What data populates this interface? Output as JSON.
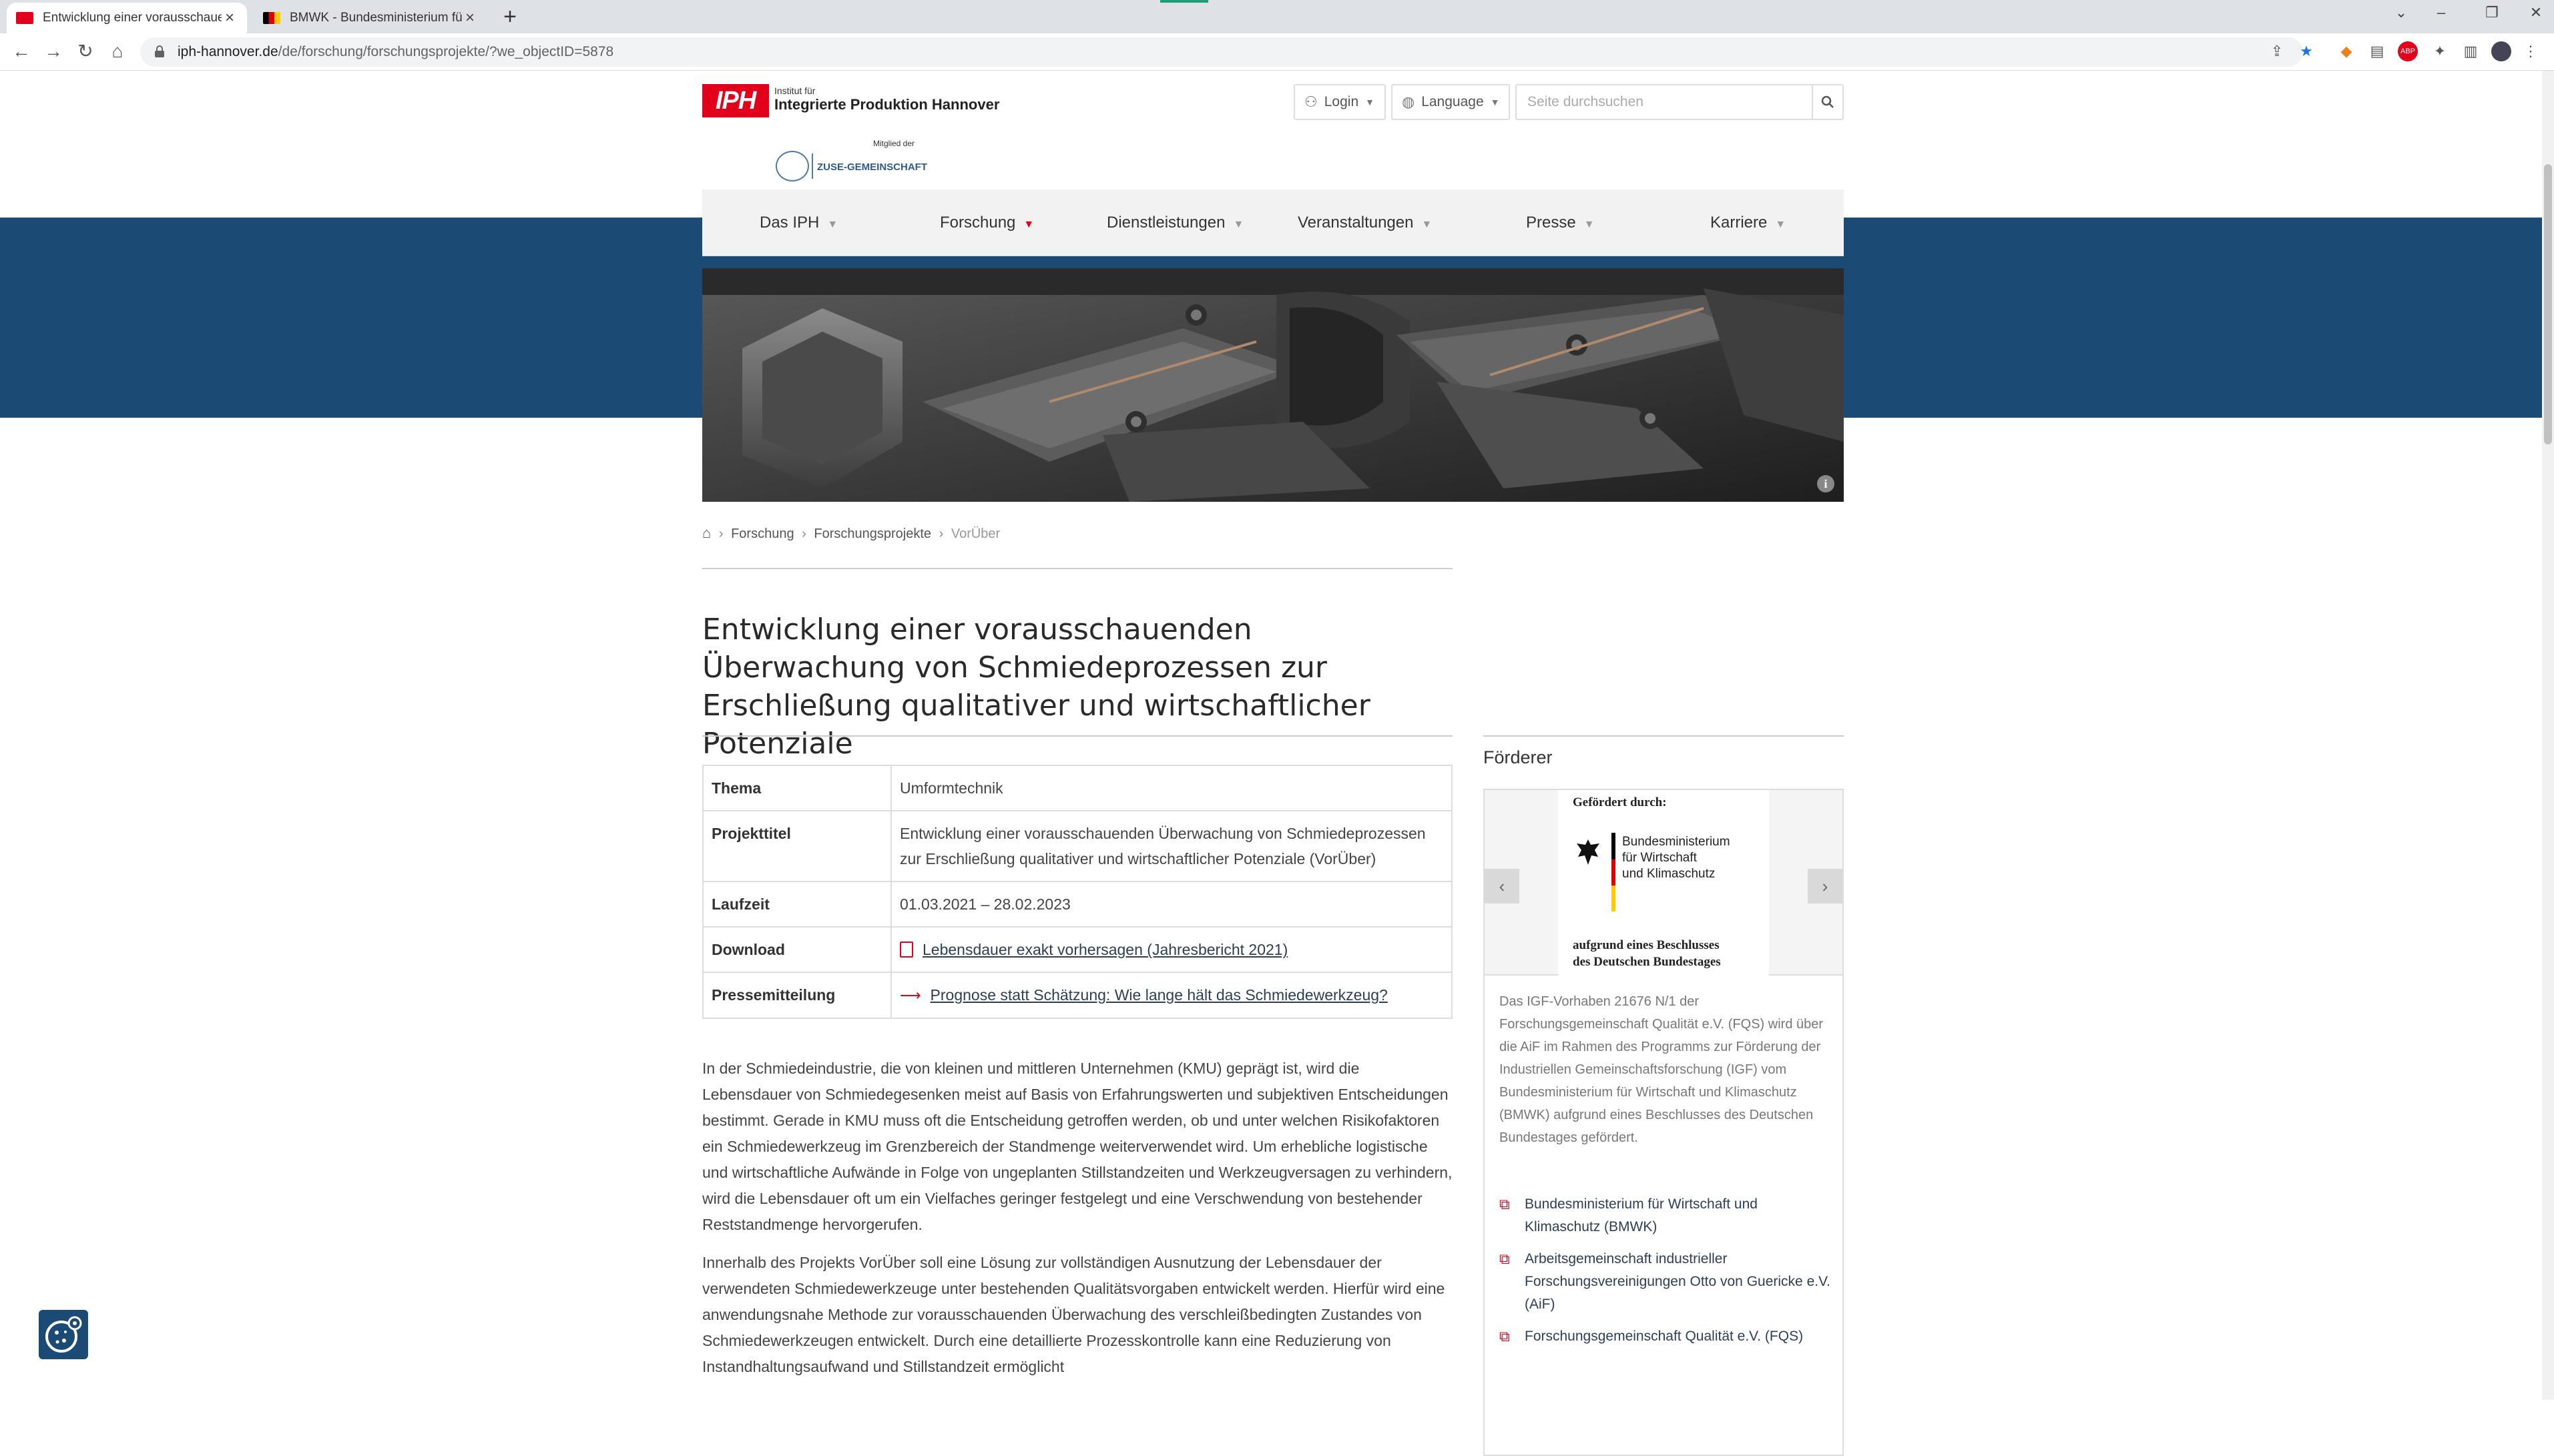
{
  "browser": {
    "tabs": [
      {
        "title": "Entwicklung einer vorausschauenden Überwachung",
        "active": true
      },
      {
        "title": "BMWK - Bundesministerium für Wirtschaft und Klimaschutz",
        "active": false
      }
    ],
    "url_host": "iph-hannover.de",
    "url_path": "/de/forschung/forschungsprojekte/?we_objectID=5878"
  },
  "header": {
    "logo_mark": "IPH",
    "logo_small": "Institut für",
    "logo_name": "Integrierte Produktion Hannover",
    "member_label": "Mitglied der",
    "zuse_label": "ZUSE-GEMEINSCHAFT",
    "login_label": "Login",
    "language_label": "Language",
    "search_placeholder": "Seite durchsuchen"
  },
  "nav": {
    "items": [
      "Das IPH",
      "Forschung",
      "Dienstleistungen",
      "Veranstaltungen",
      "Presse",
      "Karriere"
    ]
  },
  "breadcrumb": {
    "items": [
      "Forschung",
      "Forschungsprojekte"
    ],
    "current": "VorÜber"
  },
  "page_title": "Entwicklung einer vorausschauenden Überwachung von Schmiedeprozessen zur Erschließung qualitativer und wirtschaftlicher Potenziale",
  "info": {
    "thema_label": "Thema",
    "thema_value": "Umformtechnik",
    "projekttitel_label": "Projekttitel",
    "projekttitel_value": "Entwicklung einer vorausschauenden Überwachung von Schmiedeprozessen zur Erschließung qualitativer und wirtschaftlicher Potenziale (VorÜber)",
    "laufzeit_label": "Laufzeit",
    "laufzeit_value": "01.03.2021 – 28.02.2023",
    "download_label": "Download",
    "download_link": "Lebensdauer exakt vorhersagen (Jahresbericht 2021)",
    "presse_label": "Pressemitteilung",
    "presse_link": "Prognose statt Schätzung: Wie lange hält das Schmiedewerkzeug?"
  },
  "body": {
    "p1": "In der Schmiedeindustrie, die von kleinen und mittleren Unternehmen (KMU) geprägt ist, wird die Lebensdauer von Schmiedegesenken meist auf Basis von Erfahrungswerten und subjektiven Entscheidungen bestimmt. Gerade in KMU muss oft die Entscheidung getroffen werden, ob und unter welchen Risikofaktoren ein Schmiedewerkzeug im Grenzbereich der Standmenge weiterverwendet wird. Um erhebliche logistische und wirtschaftliche Aufwände in Folge von ungeplanten Stillstandzeiten und Werkzeugversagen zu verhindern, wird die Lebensdauer oft um ein Vielfaches geringer festgelegt und eine Verschwendung von bestehender Reststandmenge hervorgerufen.",
    "p2": "Innerhalb des Projekts VorÜber soll eine Lösung zur vollständigen Ausnutzung der Lebensdauer der verwendeten Schmiedewerkzeuge unter bestehenden Qualitätsvorgaben entwickelt werden. Hierfür wird eine anwendungsnahe Methode zur vorausschauenden Überwachung des verschleißbedingten Zustandes von Schmiedewerkzeugen entwickelt. Durch eine detaillierte Prozesskontrolle kann eine Reduzierung von Instandhaltungsaufwand und Stillstandzeit ermöglicht"
  },
  "sidebar": {
    "title": "Förderer",
    "slide_top": "Gefördert durch:",
    "ministry_line1": "Bundesministerium",
    "ministry_line2": "für Wirtschaft",
    "ministry_line3": "und Klimaschutz",
    "slide_bottom1": "aufgrund eines Beschlusses",
    "slide_bottom2": "des Deutschen Bundestages",
    "text": "Das IGF-Vorhaben 21676 N/1 der Forschungsgemeinschaft Qualität e.V. (FQS) wird über die AiF im Rahmen des Programms zur Förderung der Industriellen Gemeinschaftsforschung (IGF) vom Bundesministerium für Wirtschaft und Klimaschutz (BMWK) aufgrund eines Beschlusses des Deutschen Bundestages gefördert.",
    "links": [
      "Bundesministerium für Wirtschaft und Klimaschutz (BMWK)",
      "Arbeitsgemeinschaft industrieller Forschungsvereinigungen Otto von Guericke e.V. (AiF)",
      "Forschungsgemeinschaft Qualität e.V. (FQS)"
    ]
  },
  "colors": {
    "brand_red": "#e2001a",
    "band_blue": "#1b4a74",
    "link": "#2d3e55"
  }
}
